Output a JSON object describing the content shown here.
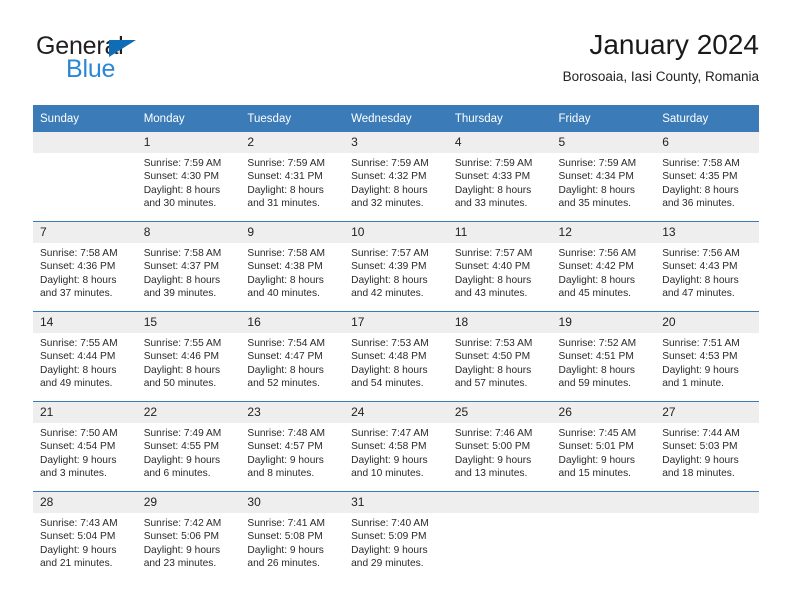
{
  "brand": {
    "name_primary": "General",
    "name_secondary": "Blue"
  },
  "header": {
    "title": "January 2024",
    "subtitle": "Borosoaia, Iasi County, Romania"
  },
  "colors": {
    "header_blue": "#3b7cb8",
    "brand_blue": "#2b87d4",
    "daynum_band": "#eeeeee"
  },
  "weekdays": [
    "Sunday",
    "Monday",
    "Tuesday",
    "Wednesday",
    "Thursday",
    "Friday",
    "Saturday"
  ],
  "weeks": [
    [
      {
        "day": "",
        "sunrise": "",
        "sunset": "",
        "daylight": "",
        "empty": true
      },
      {
        "day": "1",
        "sunrise": "Sunrise: 7:59 AM",
        "sunset": "Sunset: 4:30 PM",
        "daylight": "Daylight: 8 hours and 30 minutes."
      },
      {
        "day": "2",
        "sunrise": "Sunrise: 7:59 AM",
        "sunset": "Sunset: 4:31 PM",
        "daylight": "Daylight: 8 hours and 31 minutes."
      },
      {
        "day": "3",
        "sunrise": "Sunrise: 7:59 AM",
        "sunset": "Sunset: 4:32 PM",
        "daylight": "Daylight: 8 hours and 32 minutes."
      },
      {
        "day": "4",
        "sunrise": "Sunrise: 7:59 AM",
        "sunset": "Sunset: 4:33 PM",
        "daylight": "Daylight: 8 hours and 33 minutes."
      },
      {
        "day": "5",
        "sunrise": "Sunrise: 7:59 AM",
        "sunset": "Sunset: 4:34 PM",
        "daylight": "Daylight: 8 hours and 35 minutes."
      },
      {
        "day": "6",
        "sunrise": "Sunrise: 7:58 AM",
        "sunset": "Sunset: 4:35 PM",
        "daylight": "Daylight: 8 hours and 36 minutes."
      }
    ],
    [
      {
        "day": "7",
        "sunrise": "Sunrise: 7:58 AM",
        "sunset": "Sunset: 4:36 PM",
        "daylight": "Daylight: 8 hours and 37 minutes."
      },
      {
        "day": "8",
        "sunrise": "Sunrise: 7:58 AM",
        "sunset": "Sunset: 4:37 PM",
        "daylight": "Daylight: 8 hours and 39 minutes."
      },
      {
        "day": "9",
        "sunrise": "Sunrise: 7:58 AM",
        "sunset": "Sunset: 4:38 PM",
        "daylight": "Daylight: 8 hours and 40 minutes."
      },
      {
        "day": "10",
        "sunrise": "Sunrise: 7:57 AM",
        "sunset": "Sunset: 4:39 PM",
        "daylight": "Daylight: 8 hours and 42 minutes."
      },
      {
        "day": "11",
        "sunrise": "Sunrise: 7:57 AM",
        "sunset": "Sunset: 4:40 PM",
        "daylight": "Daylight: 8 hours and 43 minutes."
      },
      {
        "day": "12",
        "sunrise": "Sunrise: 7:56 AM",
        "sunset": "Sunset: 4:42 PM",
        "daylight": "Daylight: 8 hours and 45 minutes."
      },
      {
        "day": "13",
        "sunrise": "Sunrise: 7:56 AM",
        "sunset": "Sunset: 4:43 PM",
        "daylight": "Daylight: 8 hours and 47 minutes."
      }
    ],
    [
      {
        "day": "14",
        "sunrise": "Sunrise: 7:55 AM",
        "sunset": "Sunset: 4:44 PM",
        "daylight": "Daylight: 8 hours and 49 minutes."
      },
      {
        "day": "15",
        "sunrise": "Sunrise: 7:55 AM",
        "sunset": "Sunset: 4:46 PM",
        "daylight": "Daylight: 8 hours and 50 minutes."
      },
      {
        "day": "16",
        "sunrise": "Sunrise: 7:54 AM",
        "sunset": "Sunset: 4:47 PM",
        "daylight": "Daylight: 8 hours and 52 minutes."
      },
      {
        "day": "17",
        "sunrise": "Sunrise: 7:53 AM",
        "sunset": "Sunset: 4:48 PM",
        "daylight": "Daylight: 8 hours and 54 minutes."
      },
      {
        "day": "18",
        "sunrise": "Sunrise: 7:53 AM",
        "sunset": "Sunset: 4:50 PM",
        "daylight": "Daylight: 8 hours and 57 minutes."
      },
      {
        "day": "19",
        "sunrise": "Sunrise: 7:52 AM",
        "sunset": "Sunset: 4:51 PM",
        "daylight": "Daylight: 8 hours and 59 minutes."
      },
      {
        "day": "20",
        "sunrise": "Sunrise: 7:51 AM",
        "sunset": "Sunset: 4:53 PM",
        "daylight": "Daylight: 9 hours and 1 minute."
      }
    ],
    [
      {
        "day": "21",
        "sunrise": "Sunrise: 7:50 AM",
        "sunset": "Sunset: 4:54 PM",
        "daylight": "Daylight: 9 hours and 3 minutes."
      },
      {
        "day": "22",
        "sunrise": "Sunrise: 7:49 AM",
        "sunset": "Sunset: 4:55 PM",
        "daylight": "Daylight: 9 hours and 6 minutes."
      },
      {
        "day": "23",
        "sunrise": "Sunrise: 7:48 AM",
        "sunset": "Sunset: 4:57 PM",
        "daylight": "Daylight: 9 hours and 8 minutes."
      },
      {
        "day": "24",
        "sunrise": "Sunrise: 7:47 AM",
        "sunset": "Sunset: 4:58 PM",
        "daylight": "Daylight: 9 hours and 10 minutes."
      },
      {
        "day": "25",
        "sunrise": "Sunrise: 7:46 AM",
        "sunset": "Sunset: 5:00 PM",
        "daylight": "Daylight: 9 hours and 13 minutes."
      },
      {
        "day": "26",
        "sunrise": "Sunrise: 7:45 AM",
        "sunset": "Sunset: 5:01 PM",
        "daylight": "Daylight: 9 hours and 15 minutes."
      },
      {
        "day": "27",
        "sunrise": "Sunrise: 7:44 AM",
        "sunset": "Sunset: 5:03 PM",
        "daylight": "Daylight: 9 hours and 18 minutes."
      }
    ],
    [
      {
        "day": "28",
        "sunrise": "Sunrise: 7:43 AM",
        "sunset": "Sunset: 5:04 PM",
        "daylight": "Daylight: 9 hours and 21 minutes."
      },
      {
        "day": "29",
        "sunrise": "Sunrise: 7:42 AM",
        "sunset": "Sunset: 5:06 PM",
        "daylight": "Daylight: 9 hours and 23 minutes."
      },
      {
        "day": "30",
        "sunrise": "Sunrise: 7:41 AM",
        "sunset": "Sunset: 5:08 PM",
        "daylight": "Daylight: 9 hours and 26 minutes."
      },
      {
        "day": "31",
        "sunrise": "Sunrise: 7:40 AM",
        "sunset": "Sunset: 5:09 PM",
        "daylight": "Daylight: 9 hours and 29 minutes."
      },
      {
        "day": "",
        "sunrise": "",
        "sunset": "",
        "daylight": "",
        "empty": true
      },
      {
        "day": "",
        "sunrise": "",
        "sunset": "",
        "daylight": "",
        "empty": true
      },
      {
        "day": "",
        "sunrise": "",
        "sunset": "",
        "daylight": "",
        "empty": true
      }
    ]
  ]
}
